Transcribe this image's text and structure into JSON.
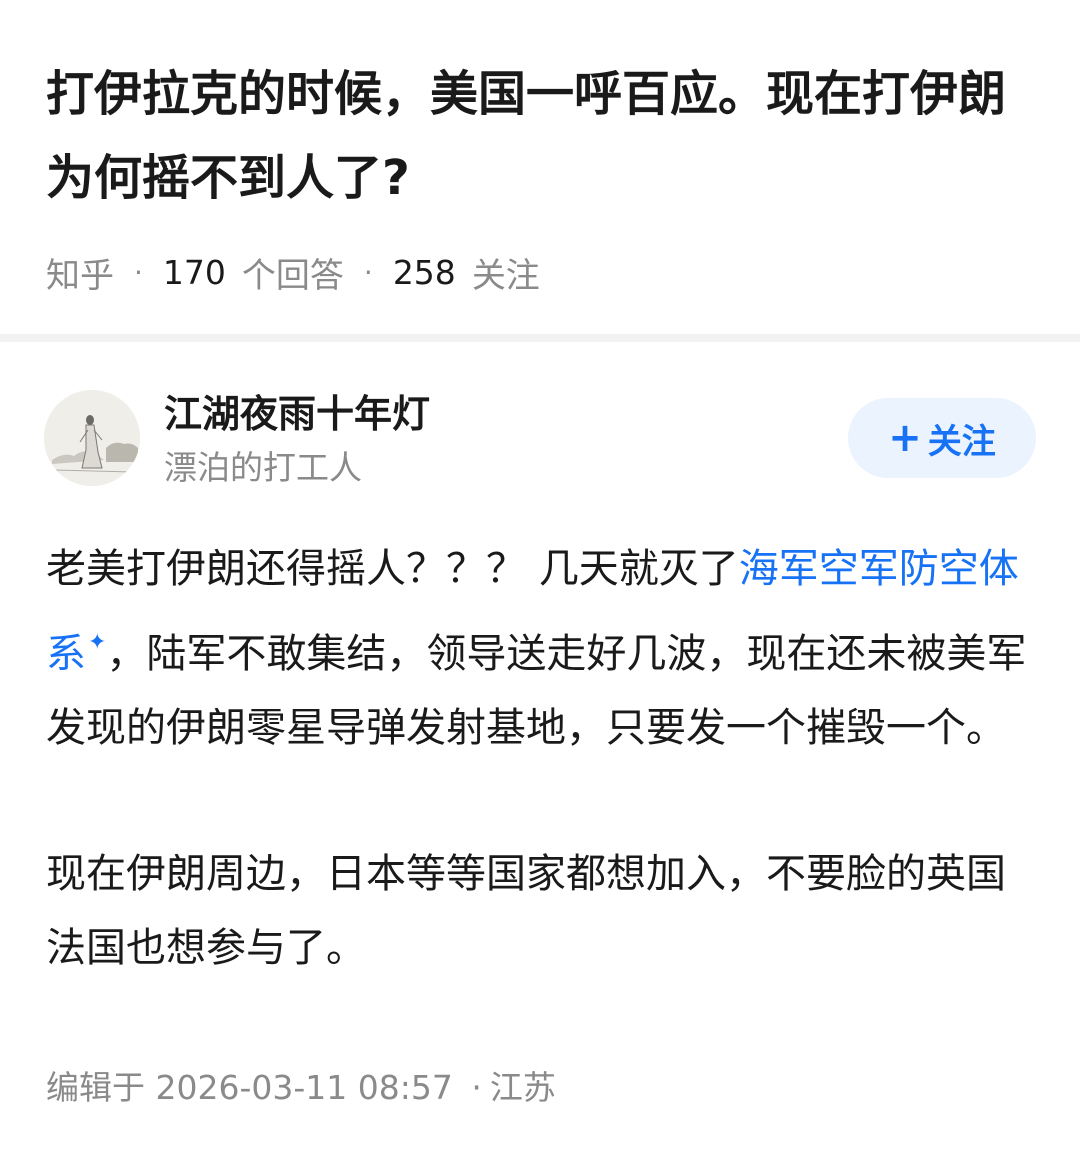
{
  "question": {
    "title": "打伊拉克的时候，美国一呼百应。现在打伊朗为何摇不到人了?",
    "source": "知乎",
    "answer_count": "170",
    "answer_unit": "个回答",
    "follow_count": "258",
    "follow_unit": "关注"
  },
  "answer": {
    "author_name": "江湖夜雨十年灯",
    "author_bio": "漂泊的打工人",
    "follow_button": "关注",
    "paragraph1_before": "老美打伊朗还得摇人？？？ 几天就灭了",
    "keyword": "海军空军防空体系",
    "paragraph1_after": "，陆军不敢集结，领导送走好几波，现在还未被美军发现的伊朗零星导弹发射基地，只要发一个摧毁一个。",
    "paragraph2": "现在伊朗周边，日本等等国家都想加入，不要脸的英国法国也想参与了。",
    "edit_label": "编辑于",
    "edit_time": "2026-03-11 08:57",
    "location": "江苏"
  },
  "colors": {
    "accent": "#1772f6",
    "follow_bg": "#ebf3fe",
    "muted": "#8a8a8a",
    "separator": "#f2f2f2"
  },
  "icons": {
    "keyword_marker": "sparkle-icon",
    "follow_plus": "plus-icon",
    "avatar": "avatar-image"
  }
}
